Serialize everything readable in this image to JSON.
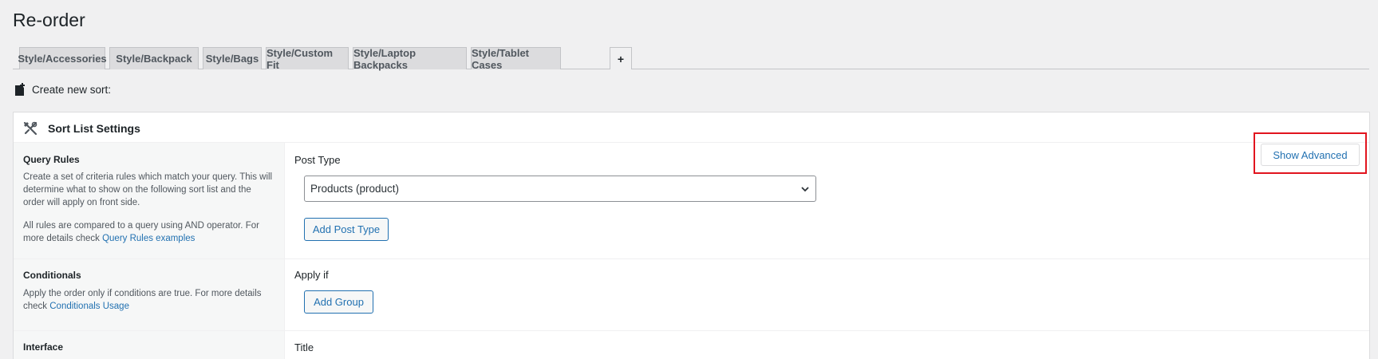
{
  "page": {
    "title": "Re-order"
  },
  "tabs": [
    {
      "label": "Style/Accessories"
    },
    {
      "label": "Style/Backpack"
    },
    {
      "label": "Style/Bags"
    },
    {
      "label": "Style/Custom Fit"
    },
    {
      "label": "Style/Laptop Backpacks"
    },
    {
      "label": "Style/Tablet Cases"
    },
    {
      "label": "+"
    }
  ],
  "create_new": {
    "label": "Create new sort:",
    "icon": "new-document-icon"
  },
  "panel": {
    "title": "Sort List Settings",
    "icon": "tools-icon",
    "show_advanced_label": "Show Advanced"
  },
  "sections": {
    "query_rules": {
      "title": "Query Rules",
      "desc1": "Create a set of criteria rules which match your query. This will determine what to show on the following sort list and the order will apply on front side.",
      "desc2_prefix": "All rules are compared to a query using AND operator. For more details check ",
      "desc2_link": "Query Rules examples",
      "field_label": "Post Type",
      "select_value": "Products (product)",
      "add_button": "Add Post Type"
    },
    "conditionals": {
      "title": "Conditionals",
      "desc_prefix": "Apply the order only if conditions are true. For more details check ",
      "desc_link": "Conditionals Usage",
      "field_label": "Apply if",
      "add_button": "Add Group"
    },
    "interface": {
      "title": "Interface",
      "field_label": "Title"
    }
  },
  "colors": {
    "accent": "#2271b1",
    "highlight": "#e1141e",
    "background": "#f0f0f1"
  }
}
